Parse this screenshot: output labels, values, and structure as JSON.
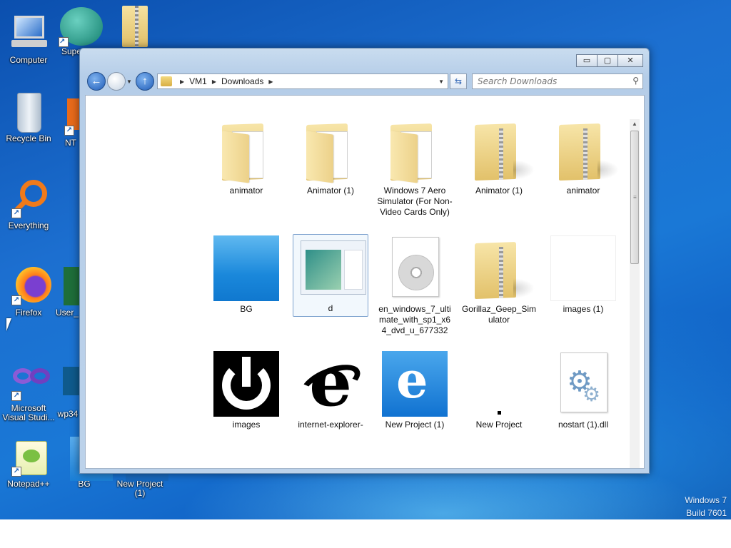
{
  "desktop": {
    "icons": [
      {
        "label": "Computer"
      },
      {
        "label": "Supe"
      },
      {
        "label": ""
      },
      {
        "label": "Recycle Bin"
      },
      {
        "label": "NT"
      },
      {
        "label": "Everything"
      },
      {
        "label": "Firefox"
      },
      {
        "label": "User_"
      },
      {
        "label": "Microsoft Visual Studi..."
      },
      {
        "label": "wp34"
      },
      {
        "label": "Notepad++"
      },
      {
        "label": "BG"
      },
      {
        "label": "New Project (1)"
      }
    ],
    "watermark": {
      "line1": "Windows 7",
      "line2": "Build 7601"
    }
  },
  "window": {
    "caption_buttons": {
      "minimize": "▭",
      "maximize": "▢",
      "close": "✕"
    },
    "breadcrumb": [
      "VM1",
      "Downloads"
    ],
    "search_placeholder": "Search Downloads",
    "items": [
      {
        "name": "animator",
        "kind": "folder-open"
      },
      {
        "name": "Animator (1)",
        "kind": "folder-open"
      },
      {
        "name": "Windows 7 Aero Simulator (For Non-Video Cards Only)",
        "kind": "folder-open"
      },
      {
        "name": "Animator (1)",
        "kind": "folder-zip"
      },
      {
        "name": "animator",
        "kind": "folder-zip"
      },
      {
        "name": "BG",
        "kind": "image-blue"
      },
      {
        "name": "d",
        "kind": "image-screenshot"
      },
      {
        "name": "en_windows_7_ultimate_with_sp1_x64_dvd_u_677332",
        "kind": "iso"
      },
      {
        "name": "Gorillaz_Geep_Simulator",
        "kind": "folder-zip"
      },
      {
        "name": "images (1)",
        "kind": "image-blank"
      },
      {
        "name": "images",
        "kind": "image-power"
      },
      {
        "name": "internet-explorer-",
        "kind": "image-ie"
      },
      {
        "name": "New Project (1)",
        "kind": "image-ie-blue"
      },
      {
        "name": "New Project",
        "kind": "image-dot"
      },
      {
        "name": "nostart (1).dll",
        "kind": "dll"
      }
    ],
    "selected_item": "d"
  },
  "colors": {
    "desktop_blue": "#1c6fd0",
    "selection": "#7da2ce"
  }
}
